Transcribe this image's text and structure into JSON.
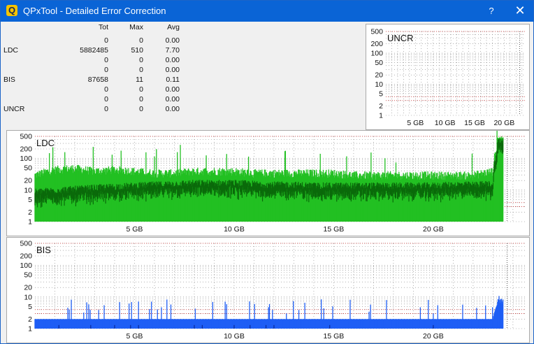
{
  "window": {
    "title": "QPxTool - Detailed Error Correction",
    "help_label": "?",
    "close_label": "✕",
    "app_icon_glyph": "Q"
  },
  "stats": {
    "headers": {
      "label": "",
      "tot": "Tot",
      "max": "Max",
      "avg": "Avg"
    },
    "rows": [
      {
        "label": "",
        "tot": "0",
        "max": "0",
        "avg": "0.00"
      },
      {
        "label": "LDC",
        "tot": "5882485",
        "max": "510",
        "avg": "7.70"
      },
      {
        "label": "",
        "tot": "0",
        "max": "0",
        "avg": "0.00"
      },
      {
        "label": "",
        "tot": "0",
        "max": "0",
        "avg": "0.00"
      },
      {
        "label": "BIS",
        "tot": "87658",
        "max": "11",
        "avg": "0.11"
      },
      {
        "label": "",
        "tot": "0",
        "max": "0",
        "avg": "0.00"
      },
      {
        "label": "",
        "tot": "0",
        "max": "0",
        "avg": "0.00"
      },
      {
        "label": "UNCR",
        "tot": "0",
        "max": "0",
        "avg": "0.00"
      }
    ]
  },
  "colors": {
    "ldc_light": "#22c022",
    "ldc_dark": "#0a6a0a",
    "bis_light": "#1e5ef5",
    "bis_dark": "#0a2a9a",
    "threshold": "#d03030",
    "grid": "#808080"
  },
  "chart_data": [
    {
      "type": "bar",
      "title": "UNCR",
      "scale": "log",
      "y_ticks": [
        "500",
        "200",
        "100",
        "50",
        "20",
        "10",
        "5",
        "2",
        "1"
      ],
      "x_ticks": [
        "5 GB",
        "10 GB",
        "15 GB",
        "20 GB"
      ],
      "xlim": [
        0,
        23.5
      ],
      "ylim": [
        1,
        500
      ],
      "series": []
    },
    {
      "type": "bar",
      "title": "LDC",
      "scale": "log",
      "y_ticks": [
        "500",
        "200",
        "100",
        "50",
        "20",
        "10",
        "5",
        "2",
        "1"
      ],
      "x_ticks": [
        "5 GB",
        "10 GB",
        "15 GB",
        "20 GB"
      ],
      "xlim": [
        0,
        24.6
      ],
      "ylim": [
        1,
        500
      ],
      "series": [
        {
          "x": [
            0,
            1,
            2,
            3,
            4,
            5,
            6,
            7,
            8,
            9,
            10,
            11,
            12,
            13,
            14,
            15,
            16,
            17,
            18,
            19,
            20,
            21,
            22,
            23,
            23.5
          ],
          "values": [
            30,
            45,
            50,
            40,
            45,
            40,
            35,
            35,
            40,
            40,
            40,
            35,
            35,
            35,
            35,
            35,
            30,
            30,
            30,
            30,
            30,
            30,
            30,
            40,
            500
          ]
        },
        {
          "x": [
            0,
            1,
            2,
            3,
            4,
            5,
            6,
            7,
            8,
            9,
            10,
            11,
            12,
            13,
            14,
            15,
            16,
            17,
            18,
            19,
            20,
            21,
            22,
            23,
            23.5
          ],
          "values": [
            9,
            10,
            11,
            12,
            13,
            14,
            15,
            16,
            17,
            17,
            17,
            16,
            15,
            15,
            14,
            14,
            14,
            14,
            14,
            14,
            14,
            15,
            15,
            16,
            400
          ]
        }
      ]
    },
    {
      "type": "bar",
      "title": "BIS",
      "scale": "log",
      "y_ticks": [
        "500",
        "200",
        "100",
        "50",
        "20",
        "10",
        "5",
        "2",
        "1"
      ],
      "x_ticks": [
        "5 GB",
        "10 GB",
        "15 GB",
        "20 GB"
      ],
      "xlim": [
        0,
        24.6
      ],
      "ylim": [
        1,
        500
      ],
      "series": [
        {
          "x": [
            0,
            1,
            2,
            3,
            4,
            5,
            6,
            7,
            8,
            9,
            10,
            11,
            12,
            13,
            14,
            15,
            16,
            17,
            18,
            19,
            20,
            21,
            22,
            23,
            23.5
          ],
          "values": [
            2,
            2,
            2,
            2,
            2,
            2,
            2,
            2,
            2,
            2,
            2,
            2,
            2,
            2,
            2,
            2,
            2,
            2,
            2,
            2,
            2,
            2,
            2,
            2,
            11
          ]
        }
      ]
    }
  ]
}
